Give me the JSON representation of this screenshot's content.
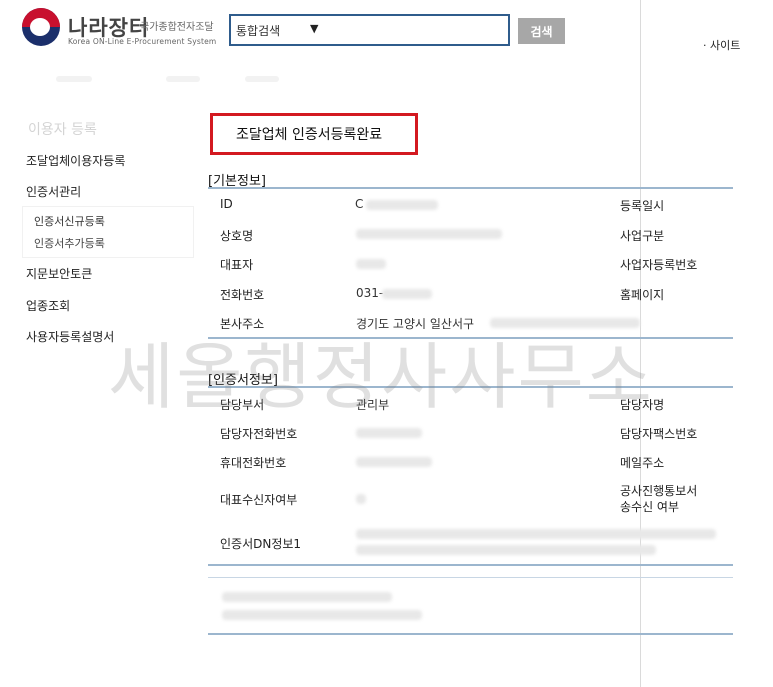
{
  "header": {
    "logo_kr": "나라장터",
    "logo_sub": "국가종합전자조달",
    "logo_en": "Korea ON-Line E-Procurement System",
    "search_select": "통합검색",
    "search_button": "검색",
    "site_map": "· 사이트"
  },
  "sidebar": {
    "title": "이용자 등록",
    "items": {
      "supplier_register": "조달업체이용자등록",
      "cert_manage": "인증서관리",
      "cert_new": "인증서신규등록",
      "cert_add": "인증서추가등록",
      "fingerprint_token": "지문보안토큰",
      "business_lookup": "업종조회",
      "user_manual": "사용자등록설명서"
    }
  },
  "main": {
    "title": "조달업체 인증서등록완료",
    "basic_info": {
      "header": "[기본정보]",
      "id_label": "ID",
      "id_value": "C",
      "reg_date_label": "등록일시",
      "company_label": "상호명",
      "biz_type_label": "사업구분",
      "ceo_label": "대표자",
      "biz_no_label": "사업자등록번호",
      "phone_label": "전화번호",
      "phone_value": "031-",
      "homepage_label": "홈페이지",
      "address_label": "본사주소",
      "address_value": "경기도 고양시 일산서구"
    },
    "cert_info": {
      "header": "[인증서정보]",
      "dept_label": "담당부서",
      "dept_value": "관리부",
      "manager_label": "담당자명",
      "manager_phone_label": "담당자전화번호",
      "manager_fax_label": "담당자팩스번호",
      "mobile_label": "휴대전화번호",
      "email_label": "메일주소",
      "ceo_receive_label": "대표수신자여부",
      "public_report_label_1": "공사진행통보서",
      "public_report_label_2": "송수신 여부",
      "dn_label": "인증서DN정보1"
    }
  },
  "watermark": "세올행정사사무소"
}
